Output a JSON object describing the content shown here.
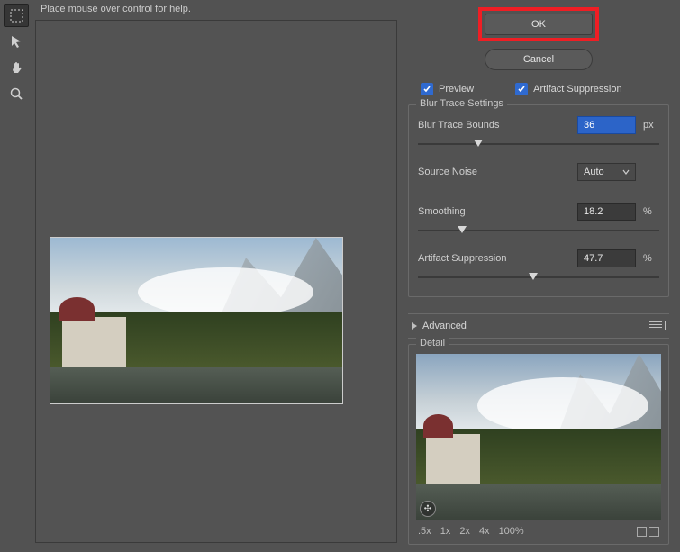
{
  "help_text": "Place mouse over control for help.",
  "buttons": {
    "ok": "OK",
    "cancel": "Cancel"
  },
  "checkboxes": {
    "preview": "Preview",
    "artifact_suppression": "Artifact Suppression"
  },
  "blur_trace": {
    "legend": "Blur Trace Settings",
    "bounds_label": "Blur Trace Bounds",
    "bounds_value": "36",
    "bounds_unit": "px",
    "bounds_pct": 25,
    "source_noise_label": "Source Noise",
    "source_noise_value": "Auto",
    "smoothing_label": "Smoothing",
    "smoothing_value": "18.2",
    "smoothing_unit": "%",
    "smoothing_pct": 18.2,
    "artifact_label": "Artifact Suppression",
    "artifact_value": "47.7",
    "artifact_unit": "%",
    "artifact_pct": 47.7
  },
  "advanced_label": "Advanced",
  "detail": {
    "legend": "Detail",
    "zoom": {
      "z05": ".5x",
      "z1": "1x",
      "z2": "2x",
      "z4": "4x",
      "z100": "100%"
    }
  }
}
